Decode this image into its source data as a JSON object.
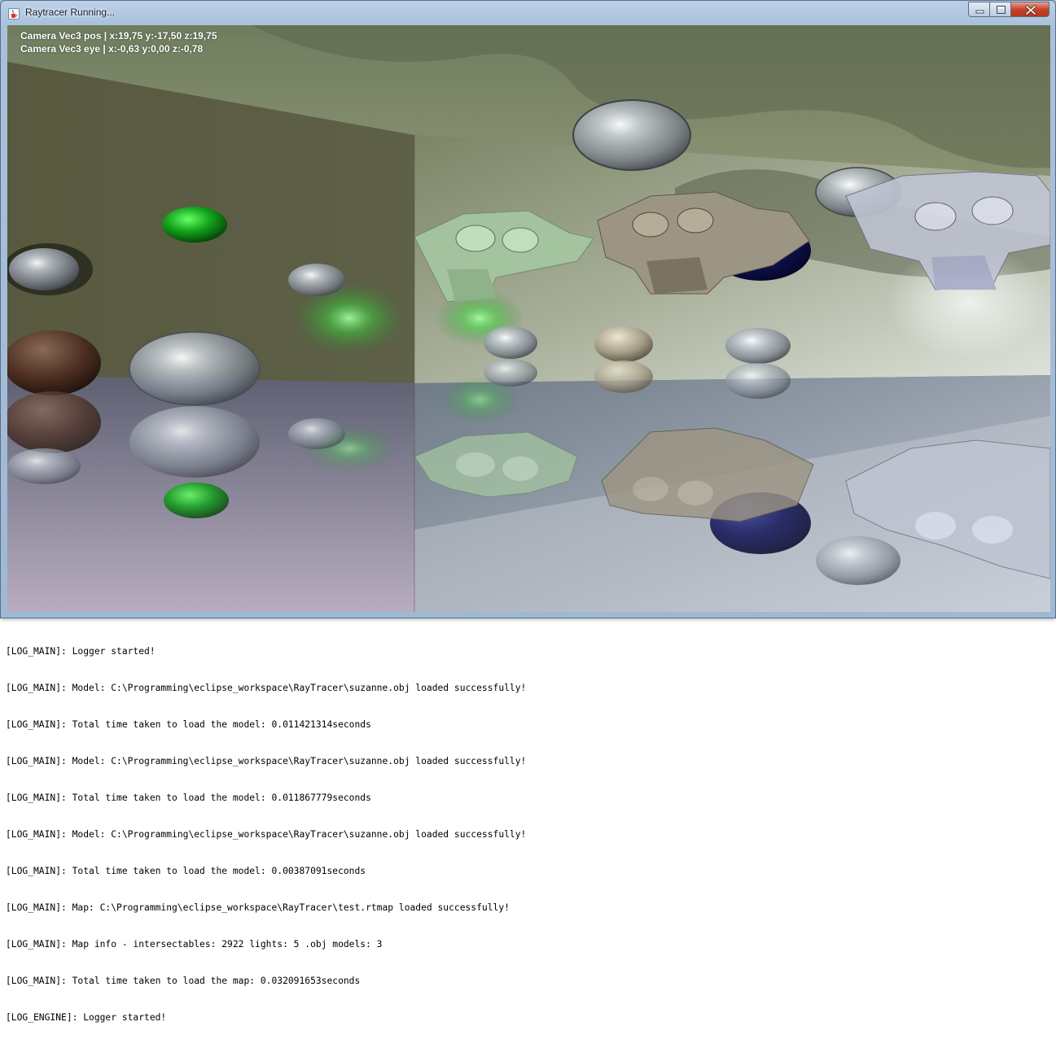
{
  "window": {
    "title": "Raytracer Running..."
  },
  "hud": {
    "camera_pos": "Camera Vec3 pos | x:19,75 y:-17,50 z:19,75",
    "camera_eye": "Camera Vec3 eye | x:-0,63 y:0,00 z:-0,78"
  },
  "console": {
    "lines": [
      "[LOG_MAIN]: Logger started!",
      "[LOG_MAIN]: Model: C:\\Programming\\eclipse_workspace\\RayTracer\\suzanne.obj loaded successfully!",
      "[LOG_MAIN]: Total time taken to load the model: 0.011421314seconds",
      "[LOG_MAIN]: Model: C:\\Programming\\eclipse_workspace\\RayTracer\\suzanne.obj loaded successfully!",
      "[LOG_MAIN]: Total time taken to load the model: 0.011867779seconds",
      "[LOG_MAIN]: Model: C:\\Programming\\eclipse_workspace\\RayTracer\\suzanne.obj loaded successfully!",
      "[LOG_MAIN]: Total time taken to load the model: 0.00387091seconds",
      "[LOG_MAIN]: Map: C:\\Programming\\eclipse_workspace\\RayTracer\\test.rtmap loaded successfully!",
      "[LOG_MAIN]: Map info - intersectables: 2922 lights: 5 .obj models: 3",
      "[LOG_MAIN]: Total time taken to load the map: 0.032091653seconds",
      "[LOG_ENGINE]: Logger started!"
    ]
  },
  "icons": {
    "app": "java-cup-icon",
    "minimize": "minimize-icon",
    "maximize": "maximize-icon",
    "close": "close-icon"
  },
  "colors": {
    "close_button": "#c6432b",
    "titlebar": "#bcd0e6"
  }
}
